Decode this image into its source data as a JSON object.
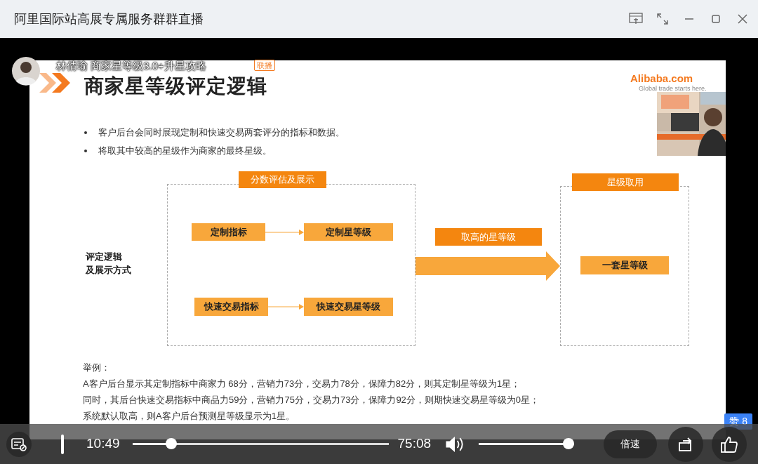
{
  "window": {
    "title": "阿里国际站高展专属服务群群直播"
  },
  "host": {
    "name": "林倩瑜 商家星等级3.0+升星攻略",
    "badge": "联播"
  },
  "slide": {
    "title": "商家星等级评定逻辑",
    "logo": "Alibaba.com",
    "logo_tagline": "Global trade starts here.",
    "bullets": [
      "客户后台会同时展现定制和快速交易两套评分的指标和数据。",
      "将取其中较高的星级作为商家的最终星级。"
    ],
    "row_label_lines": [
      "评定逻辑",
      "及展示方式"
    ],
    "groups": [
      {
        "header": "分数评估及展示"
      },
      {
        "header": "星级取用"
      }
    ],
    "nodes": [
      {
        "label": "定制指标"
      },
      {
        "label": "定制星等级"
      },
      {
        "label": "快速交易指标"
      },
      {
        "label": "快速交易星等级"
      }
    ],
    "bridge_label": "取高的星等级",
    "result": "一套星等级",
    "example_heading": "举例：",
    "example_lines": [
      "A客户后台显示其定制指标中商家力 68分，营销力73分，交易力78分，保障力82分，则其定制星等级为1星；",
      "同时，其后台快速交易指标中商品力59分，营销力75分，交易力73分，保障力92分，则期快速交易星等级为0星；",
      "系统默认取高，则A客户后台预测星等级显示为1星。"
    ]
  },
  "player": {
    "current_time": "10:49",
    "progress": {
      "level": 0.137
    },
    "duration": "75:08",
    "volume": {
      "level": 1
    },
    "speed_button": "倍速",
    "likes": "赞 8"
  }
}
